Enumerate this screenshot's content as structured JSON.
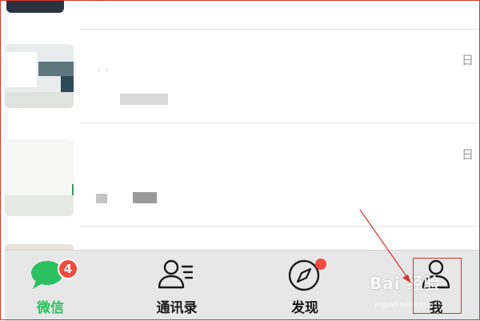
{
  "chat_list": {
    "rows": [
      {
        "time": "日"
      },
      {
        "time": "日"
      }
    ]
  },
  "tabbar": {
    "tabs": [
      {
        "label": "微信",
        "badge": "4",
        "active": true,
        "icon": "chat-bubble-icon"
      },
      {
        "label": "通讯录",
        "icon": "contacts-icon"
      },
      {
        "label": "发现",
        "icon": "compass-icon",
        "dot": true
      },
      {
        "label": "我",
        "icon": "person-icon"
      }
    ]
  },
  "colors": {
    "active": "#2bc160",
    "badge": "#f24a3c",
    "annotation": "#d9342b",
    "tabbar_bg": "#e7e7e7"
  },
  "watermark": {
    "main": "Bai 经验",
    "sub": "jingyan.baidu.com"
  }
}
